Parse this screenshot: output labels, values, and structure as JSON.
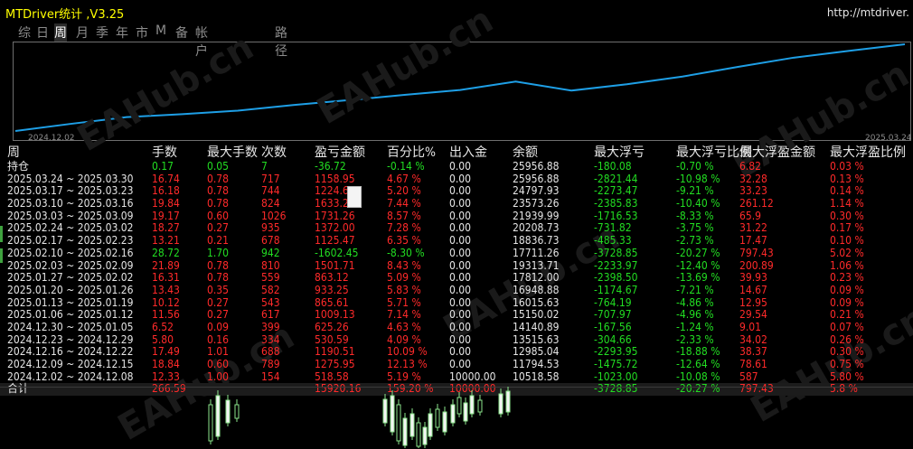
{
  "window": {
    "title": "MTDriver统计 ,V3.25",
    "url": "http://mtdriver."
  },
  "tabs": [
    {
      "label": "综",
      "active": false
    },
    {
      "label": "日",
      "active": false
    },
    {
      "label": "周",
      "active": true
    },
    {
      "label": "月",
      "active": false
    },
    {
      "label": "季",
      "active": false
    },
    {
      "label": "年",
      "active": false
    },
    {
      "label": "市",
      "active": false
    },
    {
      "label": "M",
      "active": false
    },
    {
      "label": "备",
      "active": false
    },
    {
      "label": "帐户",
      "active": false
    },
    {
      "label": "路径",
      "active": false
    }
  ],
  "chart_data": {
    "type": "line",
    "x_start_label": "2024.12.02",
    "x_end_label": "2025.03.24",
    "x": [
      "2024.12.02",
      "2024.12.09",
      "2024.12.16",
      "2024.12.23",
      "2024.12.30",
      "2025.01.06",
      "2025.01.13",
      "2025.01.20",
      "2025.01.27",
      "2025.02.03",
      "2025.02.10",
      "2025.02.17",
      "2025.02.24",
      "2025.03.03",
      "2025.03.10",
      "2025.03.17",
      "2025.03.24"
    ],
    "y": [
      10518.58,
      11794.53,
      12985.04,
      13515.63,
      14140.89,
      15150.02,
      16015.63,
      16948.88,
      17812.0,
      19313.71,
      17711.26,
      18836.73,
      20208.73,
      21939.99,
      23573.26,
      24797.93,
      25956.88
    ],
    "line_color": "#1e9fe6",
    "grid": false
  },
  "table": {
    "headers": [
      "周",
      "手数",
      "最大手数",
      "次数",
      "盈亏金额",
      "百分比%",
      "出入金",
      "余额",
      "最大浮亏",
      "最大浮亏比例",
      "最大浮盈金额",
      "最大浮盈比例"
    ],
    "holding": {
      "label": "持仓",
      "values": [
        "0.17",
        "0.05",
        "7",
        "-36.72",
        "-0.14 %",
        "0.00",
        "25956.88",
        "-180.08",
        "-0.70 %",
        "6.82",
        "0.03 %"
      ]
    },
    "rows": [
      [
        "2025.03.24 ~ 2025.03.30",
        "16.74",
        "0.78",
        "717",
        "1158.95",
        "4.67 %",
        "0.00",
        "25956.88",
        "-2821.44",
        "-10.98 %",
        "32.28",
        "0.13 %"
      ],
      [
        "2025.03.17 ~ 2025.03.23",
        "16.18",
        "0.78",
        "744",
        "1224.67",
        "5.20 %",
        "0.00",
        "24797.93",
        "-2273.47",
        "-9.21 %",
        "33.23",
        "0.14 %"
      ],
      [
        "2025.03.10 ~ 2025.03.16",
        "19.84",
        "0.78",
        "824",
        "1633.27",
        "7.44 %",
        "0.00",
        "23573.26",
        "-2385.83",
        "-10.40 %",
        "261.12",
        "1.14 %"
      ],
      [
        "2025.03.03 ~ 2025.03.09",
        "19.17",
        "0.60",
        "1026",
        "1731.26",
        "8.57 %",
        "0.00",
        "21939.99",
        "-1716.53",
        "-8.33 %",
        "65.9",
        "0.30 %"
      ],
      [
        "2025.02.24 ~ 2025.03.02",
        "18.27",
        "0.27",
        "935",
        "1372.00",
        "7.28 %",
        "0.00",
        "20208.73",
        "-731.82",
        "-3.75 %",
        "31.22",
        "0.17 %"
      ],
      [
        "2025.02.17 ~ 2025.02.23",
        "13.21",
        "0.21",
        "678",
        "1125.47",
        "6.35 %",
        "0.00",
        "18836.73",
        "-485.33",
        "-2.73 %",
        "17.47",
        "0.10 %"
      ],
      [
        "2025.02.10 ~ 2025.02.16",
        "28.72",
        "1.70",
        "942",
        "-1602.45",
        "-8.30 %",
        "0.00",
        "17711.26",
        "-3728.85",
        "-20.27 %",
        "797.43",
        "5.02 %"
      ],
      [
        "2025.02.03 ~ 2025.02.09",
        "21.89",
        "0.78",
        "810",
        "1501.71",
        "8.43 %",
        "0.00",
        "19313.71",
        "-2233.97",
        "-12.40 %",
        "200.89",
        "1.06 %"
      ],
      [
        "2025.01.27 ~ 2025.02.02",
        "16.31",
        "0.78",
        "559",
        "863.12",
        "5.09 %",
        "0.00",
        "17812.00",
        "-2398.50",
        "-13.69 %",
        "39.93",
        "0.23 %"
      ],
      [
        "2025.01.20 ~ 2025.01.26",
        "13.43",
        "0.35",
        "582",
        "933.25",
        "5.83 %",
        "0.00",
        "16948.88",
        "-1174.67",
        "-7.21 %",
        "14.67",
        "0.09 %"
      ],
      [
        "2025.01.13 ~ 2025.01.19",
        "10.12",
        "0.27",
        "543",
        "865.61",
        "5.71 %",
        "0.00",
        "16015.63",
        "-764.19",
        "-4.86 %",
        "12.95",
        "0.09 %"
      ],
      [
        "2025.01.06 ~ 2025.01.12",
        "11.56",
        "0.27",
        "617",
        "1009.13",
        "7.14 %",
        "0.00",
        "15150.02",
        "-707.97",
        "-4.96 %",
        "29.54",
        "0.21 %"
      ],
      [
        "2024.12.30 ~ 2025.01.05",
        "6.52",
        "0.09",
        "399",
        "625.26",
        "4.63 %",
        "0.00",
        "14140.89",
        "-167.56",
        "-1.24 %",
        "9.01",
        "0.07 %"
      ],
      [
        "2024.12.23 ~ 2024.12.29",
        "5.80",
        "0.16",
        "334",
        "530.59",
        "4.09 %",
        "0.00",
        "13515.63",
        "-304.66",
        "-2.33 %",
        "34.02",
        "0.26 %"
      ],
      [
        "2024.12.16 ~ 2024.12.22",
        "17.49",
        "1.01",
        "688",
        "1190.51",
        "10.09 %",
        "0.00",
        "12985.04",
        "-2293.95",
        "-18.88 %",
        "38.37",
        "0.30 %"
      ],
      [
        "2024.12.09 ~ 2024.12.15",
        "18.84",
        "0.60",
        "789",
        "1275.95",
        "12.13 %",
        "0.00",
        "11794.53",
        "-1475.72",
        "-12.64 %",
        "78.61",
        "0.75 %"
      ],
      [
        "2024.12.02 ~ 2024.12.08",
        "12.33",
        "1.00",
        "154",
        "518.58",
        "5.19 %",
        "10000.00",
        "10518.58",
        "-1023.00",
        "-10.08 %",
        "587",
        "5.80 %"
      ]
    ],
    "total": {
      "label": "合计",
      "values": [
        "266.59",
        "",
        "",
        "15920.16",
        "159.20 %",
        "10000.00",
        "",
        "-3728.85",
        "-20.27 %",
        "797.43",
        "5.8 %"
      ]
    }
  },
  "watermark": "EAHub.cn",
  "colors": {
    "title": "#ffff00",
    "positive": "#ff2a2a",
    "negative": "#22dd22",
    "neutral": "#e6e6e6",
    "line": "#1e9fe6"
  }
}
